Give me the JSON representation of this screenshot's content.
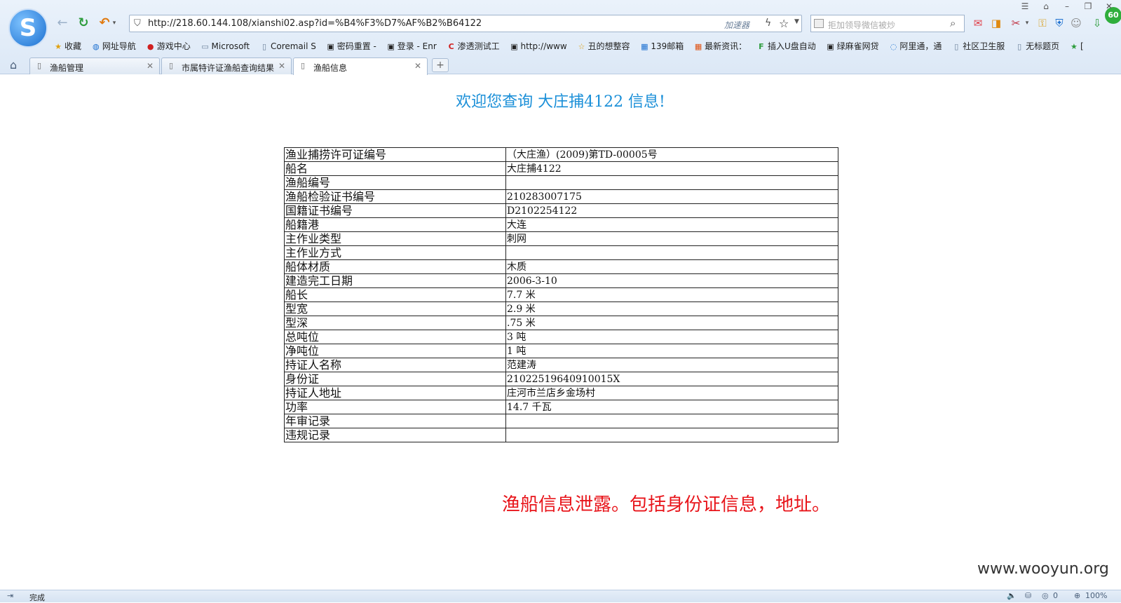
{
  "browser": {
    "logo_letter": "S",
    "address": {
      "url": "http://218.60.144.108/xianshi02.asp?id=%B4%F3%D7%AF%B2%B64122",
      "accelerator_label": "加速器"
    },
    "search": {
      "placeholder": "拒加领导微信被炒"
    },
    "badge": "60",
    "bookmarks": [
      {
        "icon": "star-icon",
        "label": "收藏"
      },
      {
        "icon": "globe-icon",
        "label": "网址导航"
      },
      {
        "icon": "game-icon",
        "label": "游戏中心"
      },
      {
        "icon": "folder-icon",
        "label": "Microsoft"
      },
      {
        "icon": "page-icon",
        "label": "Coremail S"
      },
      {
        "icon": "image-icon",
        "label": "密码重置 -"
      },
      {
        "icon": "image-icon",
        "label": "登录 - Enr"
      },
      {
        "icon": "c-logo-icon",
        "label": "渗透测试工"
      },
      {
        "icon": "image-icon",
        "label": "http://www"
      },
      {
        "icon": "star-outline-icon",
        "label": "丑的想整容"
      },
      {
        "icon": "mail139-icon",
        "label": "139邮箱"
      },
      {
        "icon": "grid-icon",
        "label": "最新资讯："
      },
      {
        "icon": "f-logo-icon",
        "label": "插入U盘自动"
      },
      {
        "icon": "image-icon",
        "label": "绿麻雀网贷"
      },
      {
        "icon": "ali-icon",
        "label": "阿里通，通"
      },
      {
        "icon": "page-icon",
        "label": "社区卫生服"
      },
      {
        "icon": "page-icon",
        "label": "无标题页"
      },
      {
        "icon": "star-icon",
        "label": "["
      }
    ],
    "tabs": [
      {
        "label": "渔船管理",
        "active": false
      },
      {
        "label": "市属特许证渔船查询结果",
        "active": false
      },
      {
        "label": "渔船信息",
        "active": true
      }
    ],
    "new_tab": "+",
    "status": {
      "text": "完成",
      "zoom": "100%",
      "counter": "0"
    }
  },
  "page": {
    "title": "欢迎您查询 大庄捕4122 信息!",
    "rows": [
      {
        "key": "渔业捕捞许可证编号",
        "value": "（大庄渔）(2009)第TD-00005号"
      },
      {
        "key": "船名",
        "value": "大庄捕4122"
      },
      {
        "key": "渔船编号",
        "value": ""
      },
      {
        "key": "渔船检验证书编号",
        "value": "210283007175"
      },
      {
        "key": "国籍证书编号",
        "value": "D2102254122"
      },
      {
        "key": "船籍港",
        "value": "大连"
      },
      {
        "key": "主作业类型",
        "value": "刺网"
      },
      {
        "key": "主作业方式",
        "value": ""
      },
      {
        "key": "船体材质",
        "value": "木质"
      },
      {
        "key": "建造完工日期",
        "value": "2006-3-10"
      },
      {
        "key": "船长",
        "value": "7.7 米"
      },
      {
        "key": "型宽",
        "value": "2.9 米"
      },
      {
        "key": "型深",
        "value": ".75 米"
      },
      {
        "key": "总吨位",
        "value": "3 吨"
      },
      {
        "key": "净吨位",
        "value": "1 吨"
      },
      {
        "key": "持证人名称",
        "value": "范建涛"
      },
      {
        "key": "身份证",
        "value": "21022519640910015X"
      },
      {
        "key": "持证人地址",
        "value": "庄河市兰店乡金场村"
      },
      {
        "key": "功率",
        "value": "14.7 千瓦"
      },
      {
        "key": "年审记录",
        "value": ""
      },
      {
        "key": "违规记录",
        "value": ""
      }
    ],
    "annotation": "渔船信息泄露。包括身份证信息，地址。",
    "watermark": "www.wooyun.org"
  },
  "colors": {
    "title": "#1a8fd8",
    "annotation": "#e8141a"
  }
}
